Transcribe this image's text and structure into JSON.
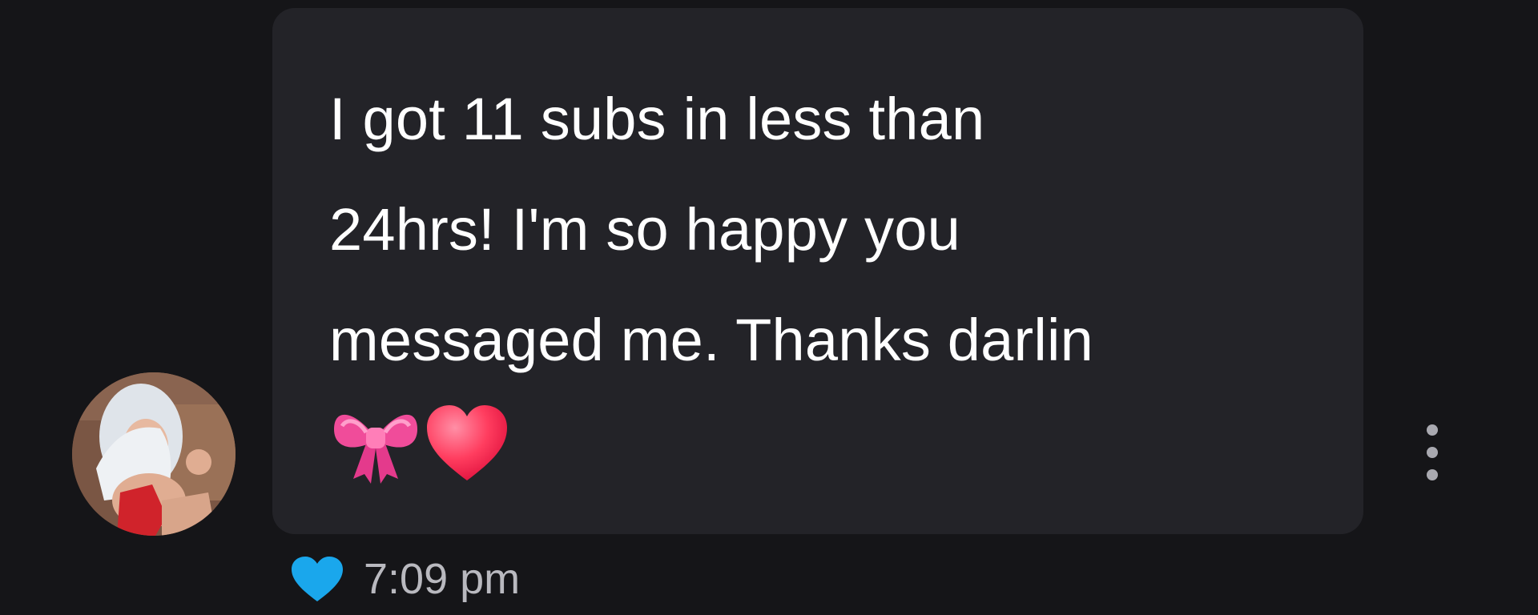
{
  "message": {
    "text": "I got 11 subs in less than\n24hrs! I'm so happy you\nmessaged me. Thanks darlin",
    "emojis": [
      "ribbon-emoji",
      "heart-emoji"
    ],
    "timestamp": "7:09 pm",
    "liked": true
  },
  "icons": {
    "like": "heart-icon",
    "more": "more-vertical-icon"
  },
  "colors": {
    "background": "#151518",
    "bubble": "#232328",
    "text": "#ffffff",
    "timestamp": "#b9b9bf",
    "like_heart": "#1aa7ec"
  }
}
